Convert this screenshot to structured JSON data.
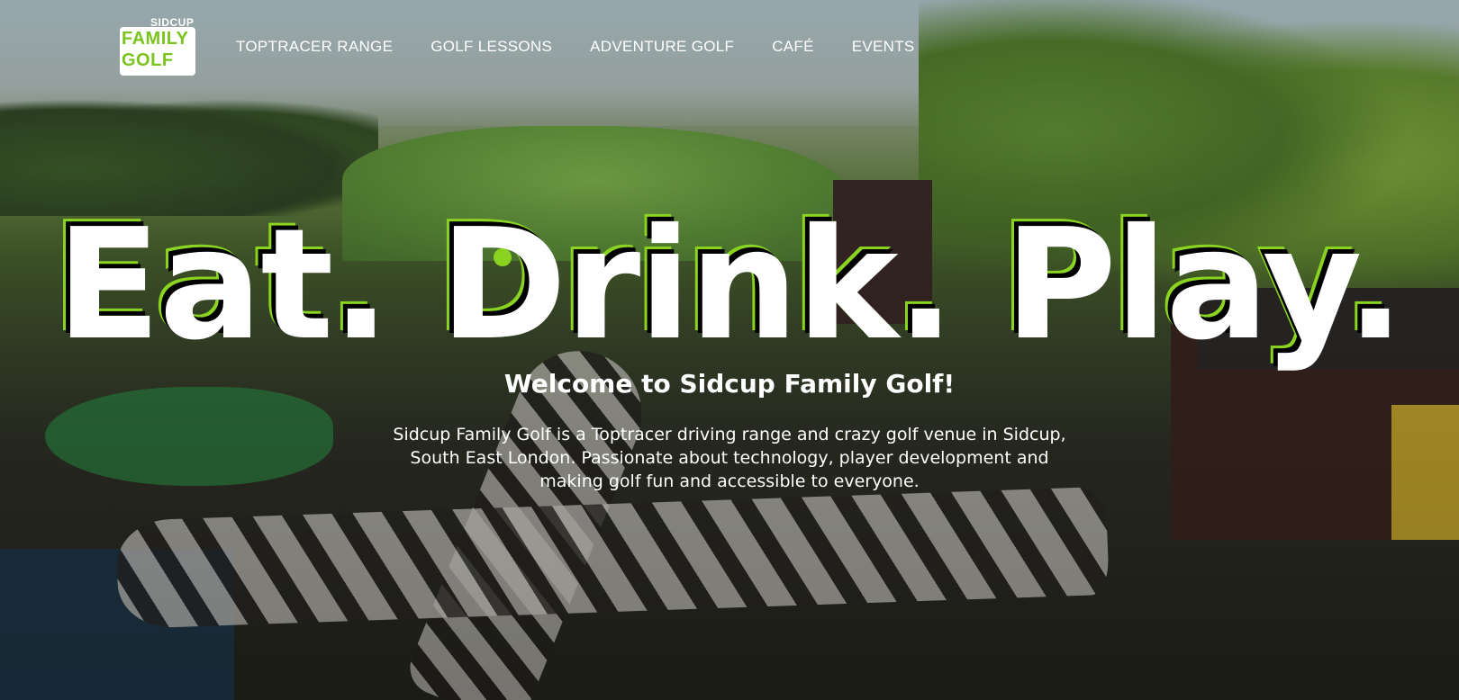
{
  "logo": {
    "top_text": "SIDCUP",
    "line1": "FAMILY",
    "line2": "GOLF"
  },
  "nav": {
    "items": [
      {
        "label": "TOPTRACER RANGE"
      },
      {
        "label": "GOLF LESSONS"
      },
      {
        "label": "ADVENTURE GOLF"
      },
      {
        "label": "CAFÉ"
      },
      {
        "label": "EVENTS"
      }
    ]
  },
  "hero": {
    "headline": "Eat. Drink. Play.",
    "subtitle": "Welcome to Sidcup Family Golf!",
    "intro": "Sidcup Family Golf is a Toptracer driving range and crazy golf venue in Sidcup, South East London. Passionate about technology, player development and making golf fun and accessible to everyone."
  },
  "colors": {
    "accent": "#8ad421",
    "text": "#ffffff"
  }
}
